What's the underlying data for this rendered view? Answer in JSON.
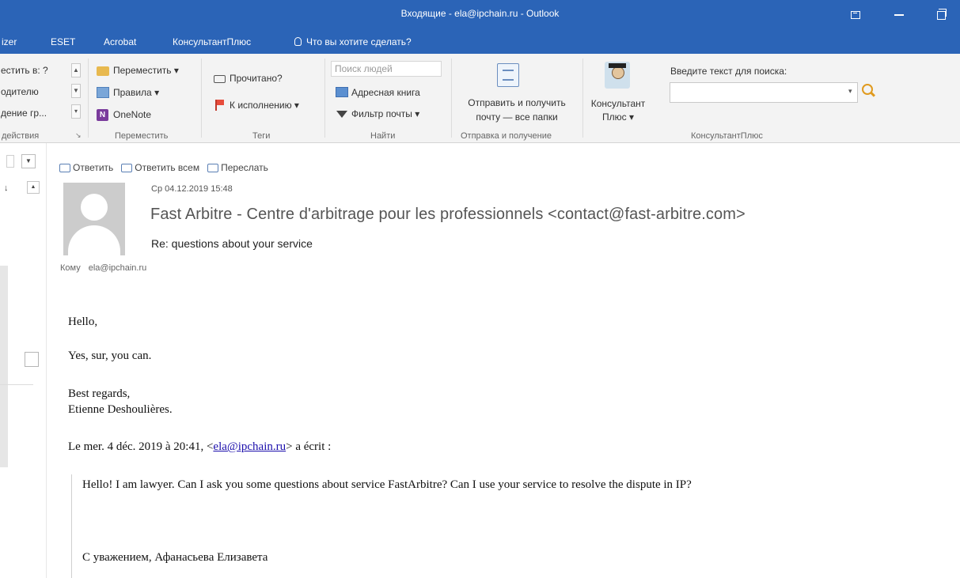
{
  "window": {
    "title": "Входящие - ela@ipchain.ru - Outlook"
  },
  "tabs": [
    {
      "label": "izer"
    },
    {
      "label": "ESET"
    },
    {
      "label": "Acrobat"
    },
    {
      "label": "КонсультантПлюс"
    },
    {
      "label": "Что вы хотите сделать?"
    }
  ],
  "ribbon": {
    "quick_steps": {
      "items": [
        "естить в: ?",
        "одителю",
        "дение гр..."
      ],
      "group_label": "действия"
    },
    "move": {
      "move_label": "Переместить",
      "rules_label": "Правила",
      "onenote_label": "OneNote",
      "group_label": "Переместить"
    },
    "tags": {
      "read_label": "Прочитано?",
      "followup_label": "К исполнению",
      "group_label": "Теги"
    },
    "find": {
      "people_placeholder": "Поиск людей",
      "address_book_label": "Адресная книга",
      "filter_label": "Фильтр почты",
      "group_label": "Найти"
    },
    "send_receive": {
      "label_line1": "Отправить и получить",
      "label_line2": "почту — все папки",
      "group_label": "Отправка и получение"
    },
    "consultant": {
      "label_line1": "Консультант",
      "label_line2": "Плюс",
      "search_prompt": "Введите текст для поиска:",
      "group_label": "КонсультантПлюс"
    }
  },
  "message": {
    "actions": {
      "reply": "Ответить",
      "reply_all": "Ответить всем",
      "forward": "Переслать"
    },
    "date": "Ср 04.12.2019 15:48",
    "sender": "Fast Arbitre - Centre d'arbitrage pour les professionnels <contact@fast-arbitre.com>",
    "subject": "Re: questions about your service",
    "to_label": "Кому",
    "to_value": "ela@ipchain.ru",
    "body": {
      "greeting": "Hello,",
      "line1": "Yes, sur, you can.",
      "closing1": "Best regards,",
      "closing2": "Etienne Deshoulières.",
      "quote_header_pre": "Le mer. 4 déc. 2019 à 20:41, <",
      "quote_header_email": "ela@ipchain.ru",
      "quote_header_post": "> a écrit :",
      "quote_line1": "Hello! I am lawyer. Can I ask you some questions about service FastArbitre? Can I use your service to resolve the dispute in IP?",
      "quote_signature": "С уважением, Афанасьева Елизавета"
    }
  },
  "colors": {
    "titlebar": "#2b64b7",
    "ribbon_bg": "#f3f3f3",
    "link": "#1a0dab"
  }
}
